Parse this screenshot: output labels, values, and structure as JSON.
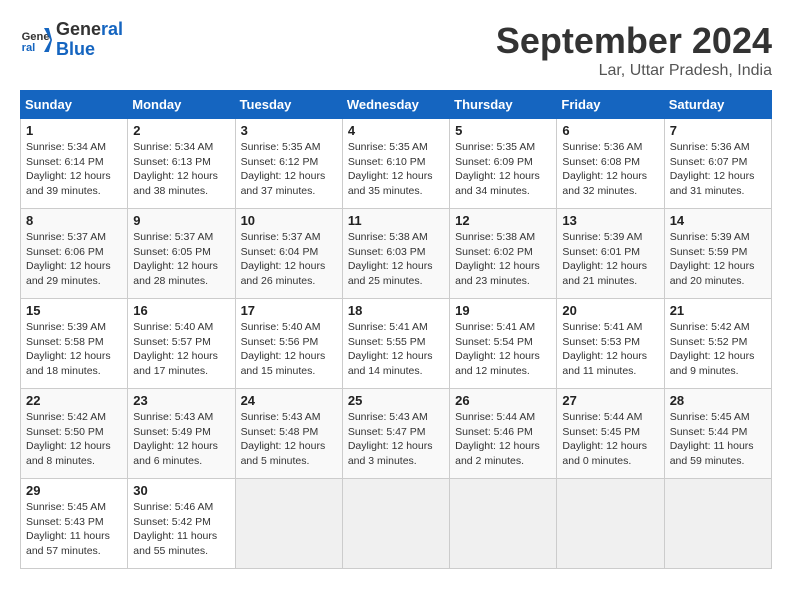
{
  "header": {
    "logo_line1": "General",
    "logo_line2": "Blue",
    "title": "September 2024",
    "subtitle": "Lar, Uttar Pradesh, India"
  },
  "weekdays": [
    "Sunday",
    "Monday",
    "Tuesday",
    "Wednesday",
    "Thursday",
    "Friday",
    "Saturday"
  ],
  "weeks": [
    [
      {
        "day": 1,
        "info": "Sunrise: 5:34 AM\nSunset: 6:14 PM\nDaylight: 12 hours\nand 39 minutes."
      },
      {
        "day": 2,
        "info": "Sunrise: 5:34 AM\nSunset: 6:13 PM\nDaylight: 12 hours\nand 38 minutes."
      },
      {
        "day": 3,
        "info": "Sunrise: 5:35 AM\nSunset: 6:12 PM\nDaylight: 12 hours\nand 37 minutes."
      },
      {
        "day": 4,
        "info": "Sunrise: 5:35 AM\nSunset: 6:10 PM\nDaylight: 12 hours\nand 35 minutes."
      },
      {
        "day": 5,
        "info": "Sunrise: 5:35 AM\nSunset: 6:09 PM\nDaylight: 12 hours\nand 34 minutes."
      },
      {
        "day": 6,
        "info": "Sunrise: 5:36 AM\nSunset: 6:08 PM\nDaylight: 12 hours\nand 32 minutes."
      },
      {
        "day": 7,
        "info": "Sunrise: 5:36 AM\nSunset: 6:07 PM\nDaylight: 12 hours\nand 31 minutes."
      }
    ],
    [
      {
        "day": 8,
        "info": "Sunrise: 5:37 AM\nSunset: 6:06 PM\nDaylight: 12 hours\nand 29 minutes."
      },
      {
        "day": 9,
        "info": "Sunrise: 5:37 AM\nSunset: 6:05 PM\nDaylight: 12 hours\nand 28 minutes."
      },
      {
        "day": 10,
        "info": "Sunrise: 5:37 AM\nSunset: 6:04 PM\nDaylight: 12 hours\nand 26 minutes."
      },
      {
        "day": 11,
        "info": "Sunrise: 5:38 AM\nSunset: 6:03 PM\nDaylight: 12 hours\nand 25 minutes."
      },
      {
        "day": 12,
        "info": "Sunrise: 5:38 AM\nSunset: 6:02 PM\nDaylight: 12 hours\nand 23 minutes."
      },
      {
        "day": 13,
        "info": "Sunrise: 5:39 AM\nSunset: 6:01 PM\nDaylight: 12 hours\nand 21 minutes."
      },
      {
        "day": 14,
        "info": "Sunrise: 5:39 AM\nSunset: 5:59 PM\nDaylight: 12 hours\nand 20 minutes."
      }
    ],
    [
      {
        "day": 15,
        "info": "Sunrise: 5:39 AM\nSunset: 5:58 PM\nDaylight: 12 hours\nand 18 minutes."
      },
      {
        "day": 16,
        "info": "Sunrise: 5:40 AM\nSunset: 5:57 PM\nDaylight: 12 hours\nand 17 minutes."
      },
      {
        "day": 17,
        "info": "Sunrise: 5:40 AM\nSunset: 5:56 PM\nDaylight: 12 hours\nand 15 minutes."
      },
      {
        "day": 18,
        "info": "Sunrise: 5:41 AM\nSunset: 5:55 PM\nDaylight: 12 hours\nand 14 minutes."
      },
      {
        "day": 19,
        "info": "Sunrise: 5:41 AM\nSunset: 5:54 PM\nDaylight: 12 hours\nand 12 minutes."
      },
      {
        "day": 20,
        "info": "Sunrise: 5:41 AM\nSunset: 5:53 PM\nDaylight: 12 hours\nand 11 minutes."
      },
      {
        "day": 21,
        "info": "Sunrise: 5:42 AM\nSunset: 5:52 PM\nDaylight: 12 hours\nand 9 minutes."
      }
    ],
    [
      {
        "day": 22,
        "info": "Sunrise: 5:42 AM\nSunset: 5:50 PM\nDaylight: 12 hours\nand 8 minutes."
      },
      {
        "day": 23,
        "info": "Sunrise: 5:43 AM\nSunset: 5:49 PM\nDaylight: 12 hours\nand 6 minutes."
      },
      {
        "day": 24,
        "info": "Sunrise: 5:43 AM\nSunset: 5:48 PM\nDaylight: 12 hours\nand 5 minutes."
      },
      {
        "day": 25,
        "info": "Sunrise: 5:43 AM\nSunset: 5:47 PM\nDaylight: 12 hours\nand 3 minutes."
      },
      {
        "day": 26,
        "info": "Sunrise: 5:44 AM\nSunset: 5:46 PM\nDaylight: 12 hours\nand 2 minutes."
      },
      {
        "day": 27,
        "info": "Sunrise: 5:44 AM\nSunset: 5:45 PM\nDaylight: 12 hours\nand 0 minutes."
      },
      {
        "day": 28,
        "info": "Sunrise: 5:45 AM\nSunset: 5:44 PM\nDaylight: 11 hours\nand 59 minutes."
      }
    ],
    [
      {
        "day": 29,
        "info": "Sunrise: 5:45 AM\nSunset: 5:43 PM\nDaylight: 11 hours\nand 57 minutes."
      },
      {
        "day": 30,
        "info": "Sunrise: 5:46 AM\nSunset: 5:42 PM\nDaylight: 11 hours\nand 55 minutes."
      },
      null,
      null,
      null,
      null,
      null
    ]
  ]
}
